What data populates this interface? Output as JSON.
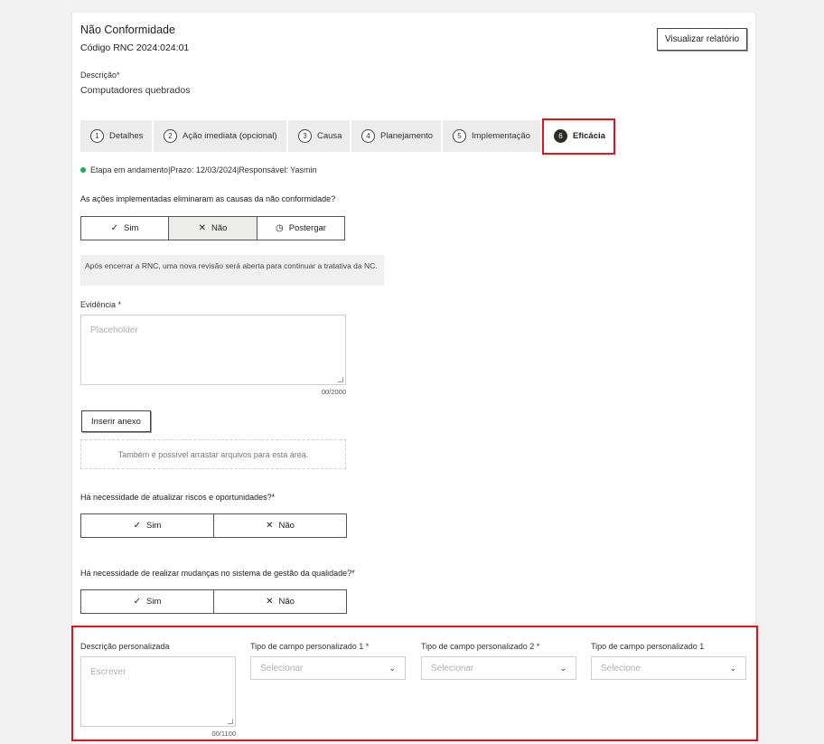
{
  "header": {
    "title": "Não Conformidade",
    "code": "Código RNC 2024:024:01",
    "report_button": "Visualizar relatório"
  },
  "description": {
    "label": "Descrição*",
    "value": "Computadores quebrados"
  },
  "tabs": [
    {
      "num": "1",
      "label": "Detalhes"
    },
    {
      "num": "2",
      "label": "Ação imediata (opcional)"
    },
    {
      "num": "3",
      "label": "Causa"
    },
    {
      "num": "4",
      "label": "Planejamento"
    },
    {
      "num": "5",
      "label": "Implementação"
    },
    {
      "num": "6",
      "label": "Eficácia",
      "active": true
    }
  ],
  "status": {
    "stage": "Etapa em andamento",
    "separator": "|",
    "deadline": "Prazo: 12/03/2024",
    "responsible": "Responsável: Yasmin",
    "dot_color": "#22a95a"
  },
  "question_actions": {
    "label": "As ações implementadas eliminaram as causas da não conformidade?",
    "options": [
      {
        "icon": "check-icon",
        "label": "Sim"
      },
      {
        "icon": "close-icon",
        "label": "Não",
        "selected": true
      },
      {
        "icon": "clock-icon",
        "label": "Postergar"
      }
    ]
  },
  "info_box": {
    "text": "Após encerrar a RNC, uma nova revisão será aberta para continuar a tratativa da NC."
  },
  "evidence": {
    "label": "Evidência *",
    "placeholder": "Placeholder",
    "counter": "00/2000"
  },
  "attachment": {
    "button": "Inserir anexo",
    "dropzone": "Também é possível arrastar arquivos para esta área."
  },
  "question_risks": {
    "label": "Há necessidade de atualizar riscos e oportunidades?*",
    "options": [
      {
        "icon": "check-icon",
        "label": "Sim"
      },
      {
        "icon": "close-icon",
        "label": "Não"
      }
    ]
  },
  "question_qms": {
    "label": "Há necessidade de realizar mudanças no sistema de gestão da qualidade?*",
    "options": [
      {
        "icon": "check-icon",
        "label": "Sim"
      },
      {
        "icon": "close-icon",
        "label": "Não"
      }
    ]
  },
  "custom_fields": {
    "description": {
      "label": "Descrição personalizada",
      "placeholder": "Escrever",
      "counter": "00/1100"
    },
    "selects": [
      {
        "label": "Tipo de campo personalizado 1 *",
        "placeholder": "Selecionar"
      },
      {
        "label": "Tipo de campo personalizado 2 *",
        "placeholder": "Selecionar"
      },
      {
        "label": "Tipo de campo personalizado 1",
        "placeholder": "Selecione"
      }
    ]
  },
  "colors": {
    "highlight": "#e0141e",
    "active_tab_badge": "#2d2d22",
    "selected_option": "#ecece8"
  }
}
